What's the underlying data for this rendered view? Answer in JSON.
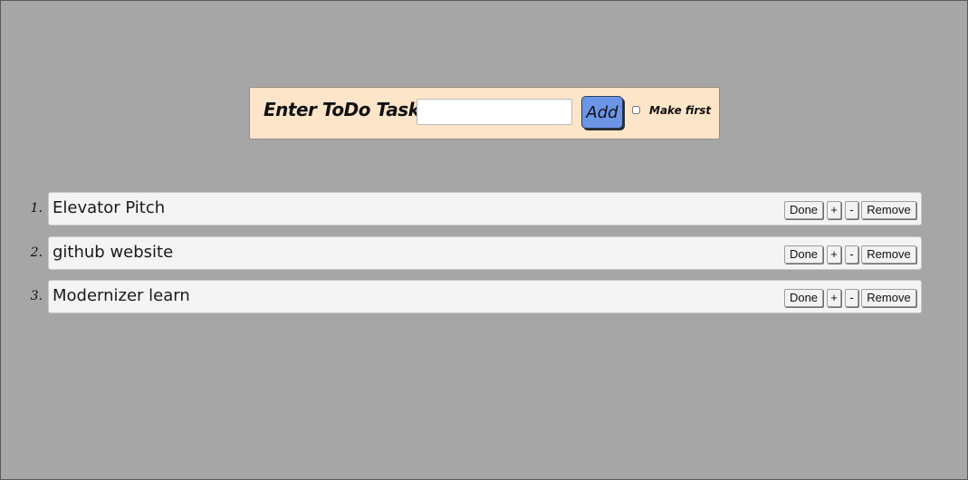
{
  "entry": {
    "label": "Enter ToDo Task",
    "input_value": "",
    "add_label": "Add",
    "first_label": "Make first",
    "first_checked": false
  },
  "tasks": [
    {
      "number": "1.",
      "text": "Elevator Pitch"
    },
    {
      "number": "2.",
      "text": "github website"
    },
    {
      "number": "3.",
      "text": "Modernizer learn"
    }
  ],
  "task_buttons": {
    "done": "Done",
    "plus": "+",
    "minus": "-",
    "remove": "Remove"
  },
  "colors": {
    "page_background": "#a6a6a6",
    "entry_panel": "#fde5c9",
    "add_button": "#6c95e6",
    "task_box": "#f4f4f4"
  }
}
